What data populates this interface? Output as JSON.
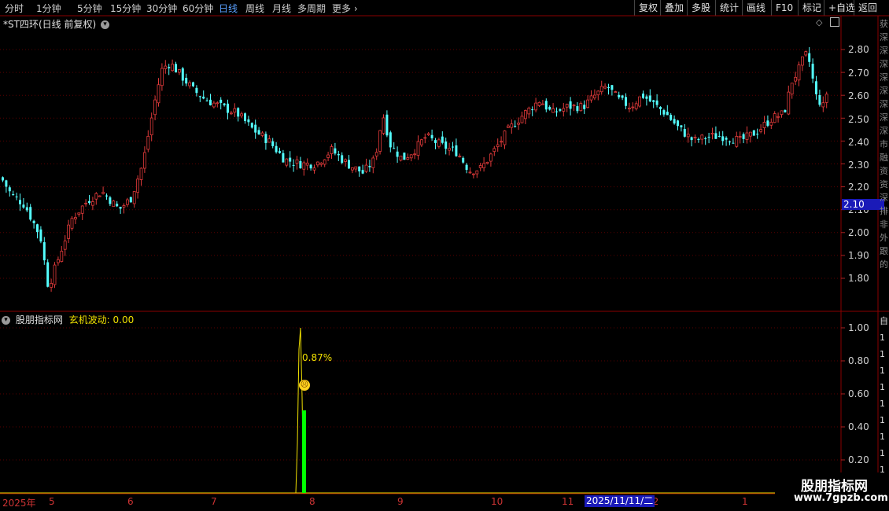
{
  "toolbar": {
    "periods": [
      "分时",
      "1分钟",
      "5分钟",
      "15分钟",
      "30分钟",
      "60分钟",
      "日线",
      "周线",
      "月线",
      "多周期",
      "更多"
    ],
    "active_period": "日线",
    "more_arrow": "›",
    "right_buttons": [
      "复权",
      "叠加",
      "多股",
      "统计",
      "画线",
      "F10",
      "标记",
      "+自选",
      "返回"
    ]
  },
  "main_chart": {
    "title": "*ST四环(日线 前复权)",
    "y_ticks": [
      "2.80",
      "2.70",
      "2.60",
      "2.50",
      "2.40",
      "2.30",
      "2.20",
      "2.10",
      "2.00",
      "1.90",
      "1.80"
    ],
    "current_price_label": "2.10",
    "up_color": "#e03a3a",
    "down_color": "#54ffff"
  },
  "sub_chart": {
    "title": "股朋指标网",
    "indicator_label": "玄机波动:",
    "indicator_value": "0.00",
    "y_ticks": [
      "1.00",
      "0.80",
      "0.60",
      "0.40",
      "0.20"
    ],
    "annotation": "0.87%",
    "line_color": "#f0e000",
    "bar_color": "#00ff00"
  },
  "x_axis": {
    "ticks": [
      "2025年",
      "5",
      "6",
      "7",
      "8",
      "9",
      "10",
      "11",
      "12",
      "1"
    ],
    "cursor_date": "2025/11/11/二"
  },
  "watermark": {
    "line1": "股朋指标网",
    "line2": "www.7gpzb.com"
  },
  "right_panel_text": "获深深深深深深深深市融资资深排非外跟的"
}
